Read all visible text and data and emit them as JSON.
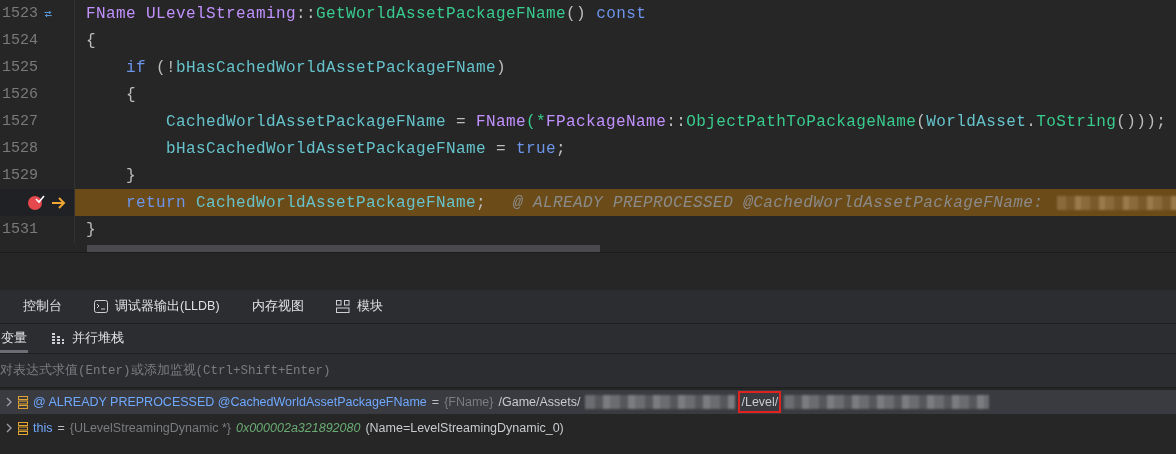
{
  "code": {
    "lines": [
      {
        "number": "1523",
        "kind": "override",
        "current": false,
        "tokens": [
          {
            "text": "FName ",
            "kind": "type"
          },
          {
            "text": "ULevelStreaming",
            "kind": "type"
          },
          {
            "text": "::",
            "kind": "punct"
          },
          {
            "text": "GetWorldAssetPackageFName",
            "kind": "function"
          },
          {
            "text": "() ",
            "kind": "punct"
          },
          {
            "text": "const",
            "kind": "keyword"
          }
        ]
      },
      {
        "number": "1524",
        "kind": "plain",
        "current": false,
        "tokens": [
          {
            "text": "{",
            "kind": "punct"
          }
        ]
      },
      {
        "number": "1525",
        "kind": "plain",
        "current": false,
        "tokens": [
          {
            "text": "    if",
            "kind": "keyword"
          },
          {
            "text": " (!",
            "kind": "punct"
          },
          {
            "text": "bHasCachedWorldAssetPackageFName",
            "kind": "variable"
          },
          {
            "text": ")",
            "kind": "punct"
          }
        ]
      },
      {
        "number": "1526",
        "kind": "plain",
        "current": false,
        "tokens": [
          {
            "text": "    {",
            "kind": "punct"
          }
        ]
      },
      {
        "number": "1527",
        "kind": "plain",
        "current": false,
        "tokens": [
          {
            "text": "        CachedWorldAssetPackageFName",
            "kind": "variable"
          },
          {
            "text": " = ",
            "kind": "punct"
          },
          {
            "text": "FName",
            "kind": "type"
          },
          {
            "text": "(*",
            "kind": "function"
          },
          {
            "text": "FPackageName",
            "kind": "type"
          },
          {
            "text": "::",
            "kind": "punct"
          },
          {
            "text": "ObjectPathToPackageName",
            "kind": "function"
          },
          {
            "text": "(",
            "kind": "punct"
          },
          {
            "text": "WorldAsset",
            "kind": "variable"
          },
          {
            "text": ".",
            "kind": "punct"
          },
          {
            "text": "ToString",
            "kind": "function"
          },
          {
            "text": "()));",
            "kind": "punct"
          }
        ]
      },
      {
        "number": "1528",
        "kind": "plain",
        "current": false,
        "tokens": [
          {
            "text": "        bHasCachedWorldAssetPackageFName",
            "kind": "variable"
          },
          {
            "text": " = ",
            "kind": "punct"
          },
          {
            "text": "true",
            "kind": "keyword"
          },
          {
            "text": ";",
            "kind": "punct"
          }
        ]
      },
      {
        "number": "1529",
        "kind": "plain",
        "current": false,
        "tokens": [
          {
            "text": "    }",
            "kind": "punct"
          }
        ]
      },
      {
        "kind": "breakpoint",
        "current": true,
        "tokens": [
          {
            "text": "    return ",
            "kind": "keyword"
          },
          {
            "text": "CachedWorldAssetPackageFName",
            "kind": "variable"
          },
          {
            "text": ";",
            "kind": "punct"
          },
          {
            "text": "@ ALREADY PREPROCESSED @CachedWorldAssetPackageFName:",
            "kind": "comment"
          },
          {
            "kind": "redacted"
          }
        ]
      },
      {
        "number": "1531",
        "kind": "plain",
        "current": false,
        "tokens": [
          {
            "text": "}",
            "kind": "punct"
          }
        ]
      }
    ]
  },
  "tool_tabs": [
    {
      "label": "控制台",
      "selected": false
    },
    {
      "label": "调试器输出(LLDB)",
      "selected": false
    },
    {
      "label": "内存视图",
      "selected": false
    },
    {
      "label": "模块",
      "selected": false
    }
  ],
  "debug_tabs": [
    {
      "label": "变量",
      "selected": true
    },
    {
      "label": "并行堆栈",
      "selected": false
    }
  ],
  "expression_field": {
    "placeholder": "对表达式求值(Enter)或添加监视(Ctrl+Shift+Enter)"
  },
  "variables": [
    {
      "selected": true,
      "parts": [
        {
          "text": "@ ALREADY PREPROCESSED @CachedWorldAssetPackageFName",
          "kind": "name"
        },
        {
          "text": "=",
          "kind": "op"
        },
        {
          "text": "{FName}",
          "kind": "type"
        },
        {
          "text": "/Game/Assets/",
          "kind": "value"
        },
        {
          "kind": "redacted"
        },
        {
          "text": "/Level/",
          "kind": "boxed"
        },
        {
          "kind": "redacted"
        }
      ]
    },
    {
      "selected": false,
      "parts": [
        {
          "text": "this",
          "kind": "name"
        },
        {
          "text": "=",
          "kind": "op"
        },
        {
          "text": "{ULevelStreamingDynamic *}",
          "kind": "type"
        },
        {
          "text": "0x000002a321892080",
          "kind": "address"
        },
        {
          "text": "(Name=LevelStreamingDynamic_0)",
          "kind": "value"
        }
      ]
    }
  ]
}
